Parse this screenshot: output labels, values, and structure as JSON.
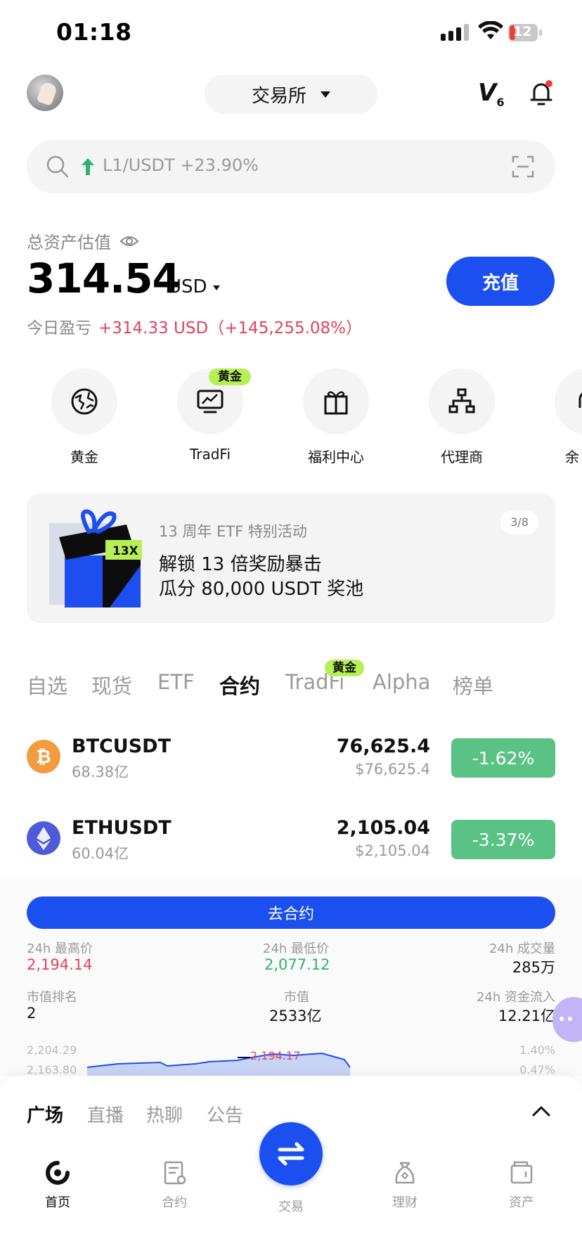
{
  "status_bar": {
    "time": "01:18",
    "battery": "12"
  },
  "header": {
    "exchange_label": "交易所",
    "vip_level": "V",
    "vip_num": "6"
  },
  "search": {
    "hint": "L1/USDT +23.90%"
  },
  "assets": {
    "label": "总资产估值",
    "value": "314.54",
    "unit": "USD",
    "pnl_label": "今日盈亏",
    "pnl_value": "+314.33 USD（+145,255.08%）",
    "deposit_label": "充值"
  },
  "shortcuts": [
    {
      "label": "黄金",
      "icon": "gold-globe-icon"
    },
    {
      "label": "TradFi",
      "icon": "chart-monitor-icon",
      "badge": "黄金"
    },
    {
      "label": "福利中心",
      "icon": "gift-icon"
    },
    {
      "label": "代理商",
      "icon": "org-chart-icon"
    },
    {
      "label": "余",
      "icon": "savings-icon"
    }
  ],
  "banner": {
    "subtitle": "13 周年 ETF 特别活动",
    "title_line1": "解锁 13 倍奖励暴击",
    "title_line2": "瓜分 80,000 USDT 奖池",
    "art_text": "13X",
    "page": "3/8"
  },
  "market_tabs": {
    "items": [
      "自选",
      "现货",
      "ETF",
      "合约",
      "TradFi",
      "Alpha",
      "榜单"
    ],
    "active": "合约",
    "tradfi_badge": "黄金"
  },
  "markets": [
    {
      "symbol": "BTCUSDT",
      "volume": "68.38亿",
      "price": "76,625.4",
      "price_usd": "$76,625.4",
      "change": "-1.62%"
    },
    {
      "symbol": "ETHUSDT",
      "volume": "60.04亿",
      "price": "2,105.04",
      "price_usd": "$2,105.04",
      "change": "-3.37%"
    }
  ],
  "detail": {
    "futures_button": "去合约",
    "high_label": "24h 最高价",
    "high": "2,194.14",
    "low_label": "24h 最低价",
    "low": "2,077.12",
    "volume_label": "24h 成交量",
    "volume": "285万",
    "rank_label": "市值排名",
    "rank": "2",
    "mcap_label": "市值",
    "mcap": "2533亿",
    "inflow_label": "24h 资金流入",
    "inflow": "12.21亿",
    "chart_high": "2,204.29",
    "chart_low": "2,163.80",
    "chart_peak": "2,194.17",
    "chart_pct_high": "1.40%",
    "chart_pct_low": "0.47%"
  },
  "community": {
    "tabs": [
      "广场",
      "直播",
      "热聊",
      "公告"
    ],
    "active": "广场"
  },
  "nav": {
    "items": [
      "首页",
      "合约",
      "交易",
      "理财",
      "资产"
    ],
    "active": "首页"
  },
  "colors": {
    "brand_blue": "#1c4ff0",
    "up_red": "#e2425c",
    "down_green": "#5bc286",
    "gold_badge": "#b7f056"
  }
}
